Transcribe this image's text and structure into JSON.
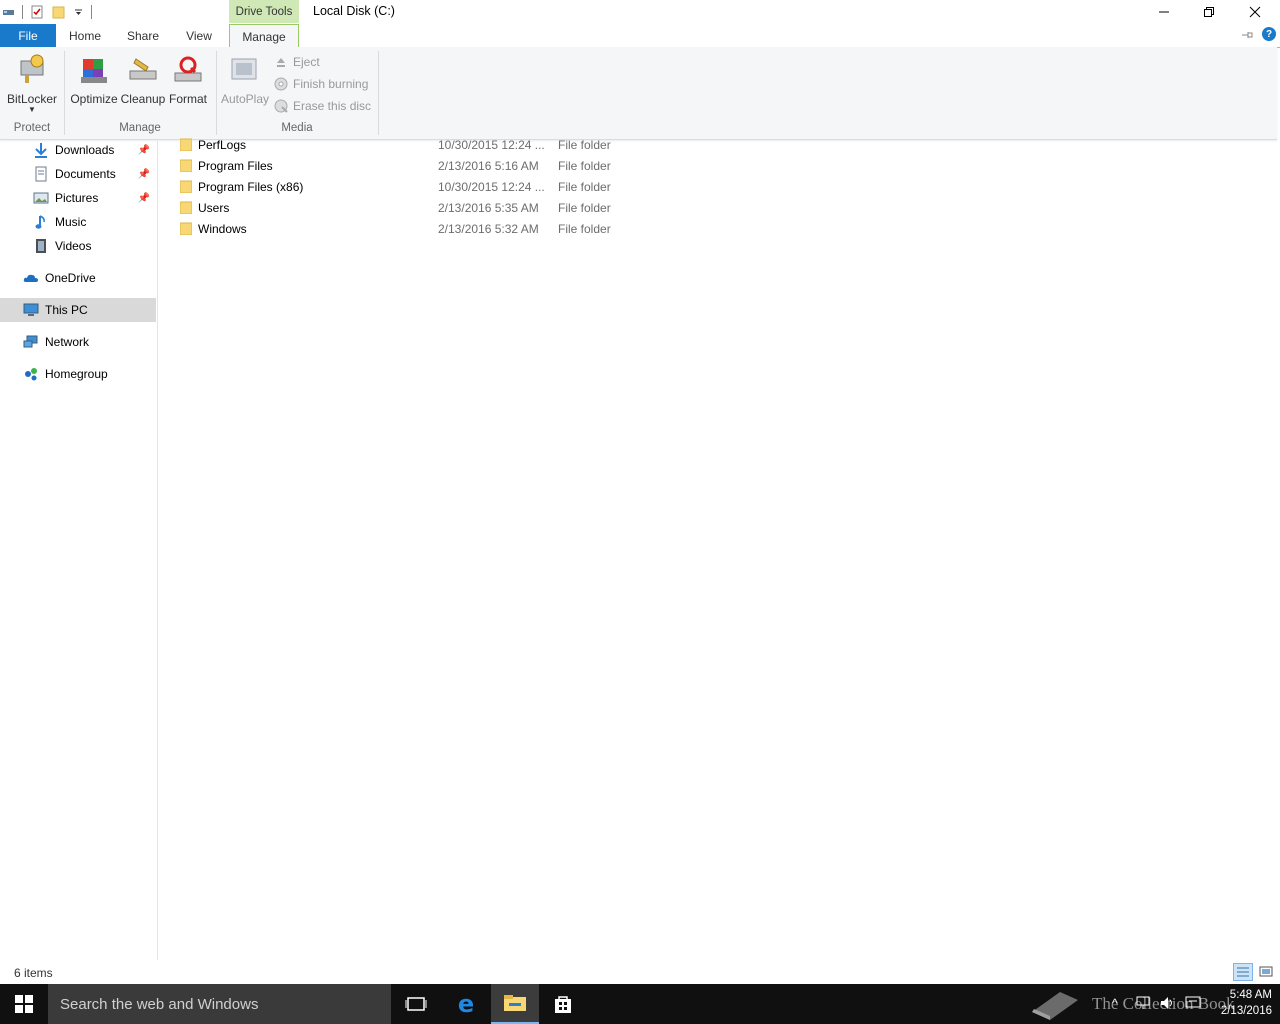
{
  "window": {
    "title": "Local Disk (C:)",
    "context_tab_group": "Drive Tools"
  },
  "ribbon_tabs": {
    "file": "File",
    "home": "Home",
    "share": "Share",
    "view": "View",
    "manage": "Manage"
  },
  "ribbon": {
    "bitlocker": "BitLocker",
    "optimize": "Optimize",
    "cleanup": "Cleanup",
    "format": "Format",
    "autoplay": "AutoPlay",
    "eject": "Eject",
    "finish_burning": "Finish burning",
    "erase_disc": "Erase this disc",
    "groups": {
      "protect": "Protect",
      "manage": "Manage",
      "media": "Media"
    }
  },
  "nav": {
    "downloads": "Downloads",
    "documents": "Documents",
    "pictures": "Pictures",
    "music": "Music",
    "videos": "Videos",
    "onedrive": "OneDrive",
    "this_pc": "This PC",
    "network": "Network",
    "homegroup": "Homegroup"
  },
  "files": [
    {
      "name": "PerfLogs",
      "date": "10/30/2015 12:24 ...",
      "type": "File folder"
    },
    {
      "name": "Program Files",
      "date": "2/13/2016 5:16 AM",
      "type": "File folder"
    },
    {
      "name": "Program Files (x86)",
      "date": "10/30/2015 12:24 ...",
      "type": "File folder"
    },
    {
      "name": "Users",
      "date": "2/13/2016 5:35 AM",
      "type": "File folder"
    },
    {
      "name": "Windows",
      "date": "2/13/2016 5:32 AM",
      "type": "File folder"
    }
  ],
  "status": {
    "item_count": "6 items"
  },
  "taskbar": {
    "search_placeholder": "Search the web and Windows",
    "time": "5:48 AM",
    "date": "2/13/2016",
    "watermark": "The Collection Book"
  },
  "colors": {
    "accent": "#1979ca",
    "context_tab": "#cfe8b5",
    "folder": "#f8d775"
  }
}
